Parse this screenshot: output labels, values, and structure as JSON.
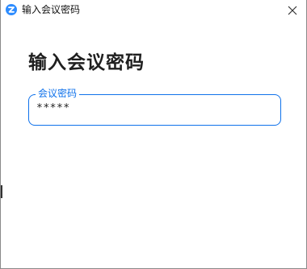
{
  "window": {
    "title": "输入会议密码",
    "app_icon": "zoom-logo-icon",
    "close_icon": "close-icon"
  },
  "dialog": {
    "heading": "输入会议密码",
    "password_field": {
      "label": "会议密码",
      "value": "*****"
    }
  },
  "colors": {
    "accent": "#0e71eb",
    "app_icon_bg": "#2d8cff",
    "text": "#1f1f1f"
  }
}
